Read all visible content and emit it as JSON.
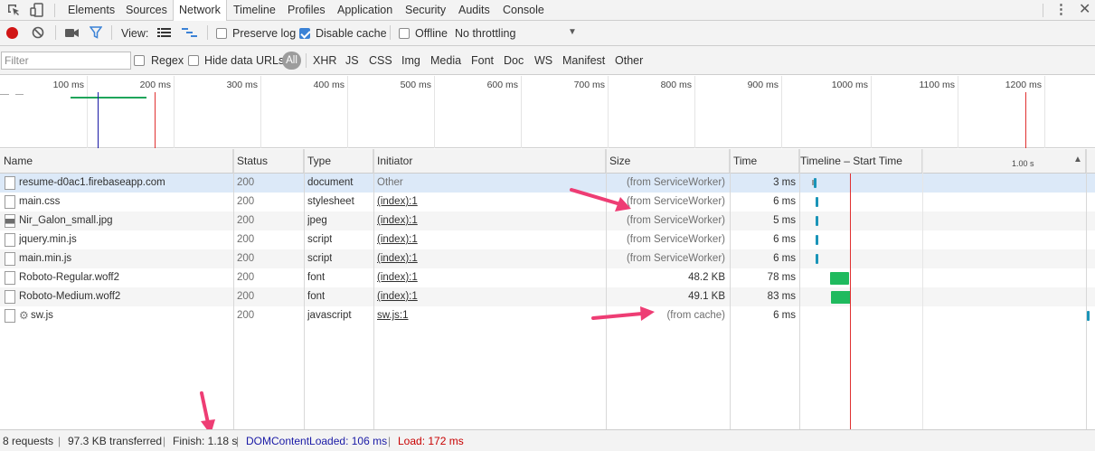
{
  "tabs": {
    "items": [
      "Elements",
      "Sources",
      "Network",
      "Timeline",
      "Profiles",
      "Application",
      "Security",
      "Audits",
      "Console"
    ],
    "active": "Network"
  },
  "toolbar": {
    "view_label": "View:",
    "preserve_log": "Preserve log",
    "disable_cache": "Disable cache",
    "offline": "Offline",
    "throttling": "No throttling"
  },
  "filterbar": {
    "placeholder": "Filter",
    "regex": "Regex",
    "hide_data_urls": "Hide data URLs",
    "all": "All",
    "types": [
      "XHR",
      "JS",
      "CSS",
      "Img",
      "Media",
      "Font",
      "Doc",
      "WS",
      "Manifest",
      "Other"
    ]
  },
  "overview": {
    "ticks": [
      "100 ms",
      "200 ms",
      "300 ms",
      "400 ms",
      "500 ms",
      "600 ms",
      "700 ms",
      "800 ms",
      "900 ms",
      "1000 ms",
      "1100 ms",
      "1200 ms"
    ]
  },
  "columns": {
    "name": "Name",
    "status": "Status",
    "type": "Type",
    "initiator": "Initiator",
    "size": "Size",
    "time": "Time",
    "timeline": "Timeline – Start Time",
    "timeline_mark": "1.00 s"
  },
  "requests": [
    {
      "name": "resume-d0ac1.firebaseapp.com",
      "status": "200",
      "type": "document",
      "initiator": "Other",
      "size": "(from ServiceWorker)",
      "time": "3 ms"
    },
    {
      "name": "main.css",
      "status": "200",
      "type": "stylesheet",
      "initiator": "(index):1",
      "size": "(from ServiceWorker)",
      "time": "6 ms"
    },
    {
      "name": "Nir_Galon_small.jpg",
      "status": "200",
      "type": "jpeg",
      "initiator": "(index):1",
      "size": "(from ServiceWorker)",
      "time": "5 ms"
    },
    {
      "name": "jquery.min.js",
      "status": "200",
      "type": "script",
      "initiator": "(index):1",
      "size": "(from ServiceWorker)",
      "time": "6 ms"
    },
    {
      "name": "main.min.js",
      "status": "200",
      "type": "script",
      "initiator": "(index):1",
      "size": "(from ServiceWorker)",
      "time": "6 ms"
    },
    {
      "name": "Roboto-Regular.woff2",
      "status": "200",
      "type": "font",
      "initiator": "(index):1",
      "size": "48.2 KB",
      "time": "78 ms"
    },
    {
      "name": "Roboto-Medium.woff2",
      "status": "200",
      "type": "font",
      "initiator": "(index):1",
      "size": "49.1 KB",
      "time": "83 ms"
    },
    {
      "name": "sw.js",
      "status": "200",
      "type": "javascript",
      "initiator": "sw.js:1",
      "size": "(from cache)",
      "time": "6 ms"
    }
  ],
  "statusbar": {
    "requests": "8 requests",
    "transferred": "97.3 KB transferred",
    "finish": "Finish: 1.18 s",
    "dcl": "DOMContentLoaded: 106 ms",
    "load": "Load: 172 ms"
  },
  "colors": {
    "dcl": "#1a1aa6",
    "load": "#c80000",
    "annotation_arrow": "#ee3d74",
    "record": "#d11515"
  }
}
